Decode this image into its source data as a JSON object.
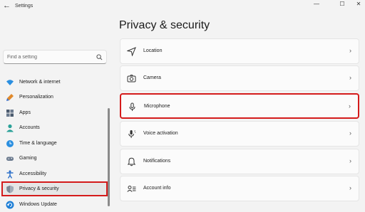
{
  "window": {
    "back_glyph": "←",
    "title": "Settings",
    "min_glyph": "—",
    "max_glyph": "☐",
    "close_glyph": "✕"
  },
  "search": {
    "placeholder": "Find a setting",
    "icon": "search-icon"
  },
  "sidebar": {
    "items": [
      {
        "label": "Network & internet",
        "icon": "wifi-icon"
      },
      {
        "label": "Personalization",
        "icon": "brush-icon"
      },
      {
        "label": "Apps",
        "icon": "apps-icon"
      },
      {
        "label": "Accounts",
        "icon": "person-icon"
      },
      {
        "label": "Time & language",
        "icon": "globe-clock-icon"
      },
      {
        "label": "Gaming",
        "icon": "gamepad-icon"
      },
      {
        "label": "Accessibility",
        "icon": "accessibility-icon"
      },
      {
        "label": "Privacy & security",
        "icon": "shield-icon",
        "selected": true
      },
      {
        "label": "Windows Update",
        "icon": "update-icon"
      }
    ]
  },
  "main": {
    "title": "Privacy & security",
    "cards": [
      {
        "label": "Location",
        "icon": "location-arrow-icon"
      },
      {
        "label": "Camera",
        "icon": "camera-icon"
      },
      {
        "label": "Microphone",
        "icon": "microphone-icon",
        "highlighted": true
      },
      {
        "label": "Voice activation",
        "icon": "voice-activation-icon"
      },
      {
        "label": "Notifications",
        "icon": "bell-icon"
      },
      {
        "label": "Account info",
        "icon": "account-info-icon"
      }
    ],
    "chevron": "›"
  },
  "colors": {
    "highlight_border": "#d41b1b",
    "background": "#f3f3f3",
    "card_background": "#fbfbfb"
  }
}
